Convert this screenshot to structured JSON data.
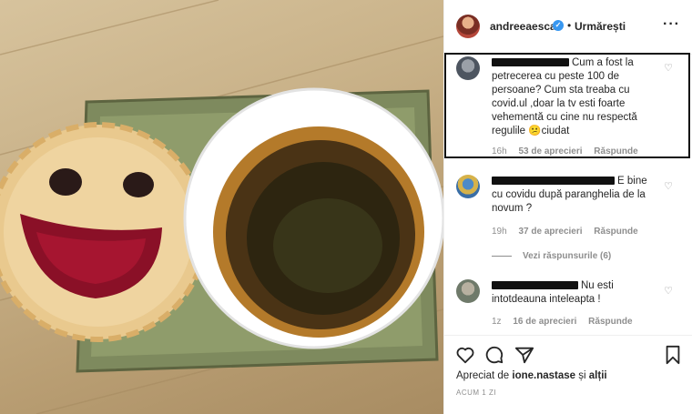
{
  "header": {
    "username": "andreeaesca",
    "verified_mark": "✓",
    "separator": "•",
    "follow_label": "Urmărești",
    "more_label": "···",
    "avatar_icon": "profile-avatar"
  },
  "comments": [
    {
      "text": "Cum a fost la petrecerea cu peste 100 de persoane? Cum sta treaba cu covid.ul ,doar la tv esti foarte vehementă cu cine nu respectă regulile",
      "emoji": "😕",
      "text_end": "ciudat",
      "time": "16h",
      "likes": "53 de aprecieri",
      "reply_label": "Răspunde",
      "highlighted": true
    },
    {
      "text": "E bine cu covidu după paranghelia de la novum ?",
      "time": "19h",
      "likes": "37 de aprecieri",
      "reply_label": "Răspunde",
      "view_replies": "Vezi răspunsurile (6)"
    },
    {
      "text": "Nu esti intotdeauna inteleapta !",
      "time": "1z",
      "likes": "16 de aprecieri",
      "reply_label": "Răspunde"
    }
  ],
  "actions": {
    "like_icon": "heart-icon",
    "comment_icon": "comment-icon",
    "share_icon": "share-icon",
    "save_icon": "bookmark-icon"
  },
  "liked_by": {
    "prefix": "Apreciat de",
    "user": "ione.nastase",
    "conj": "și",
    "others": "alții"
  },
  "timestamp": "ACUM 1 ZI",
  "colors": {
    "accent_blue": "#3897f0",
    "text": "#262626",
    "muted": "#8e8e8e"
  }
}
